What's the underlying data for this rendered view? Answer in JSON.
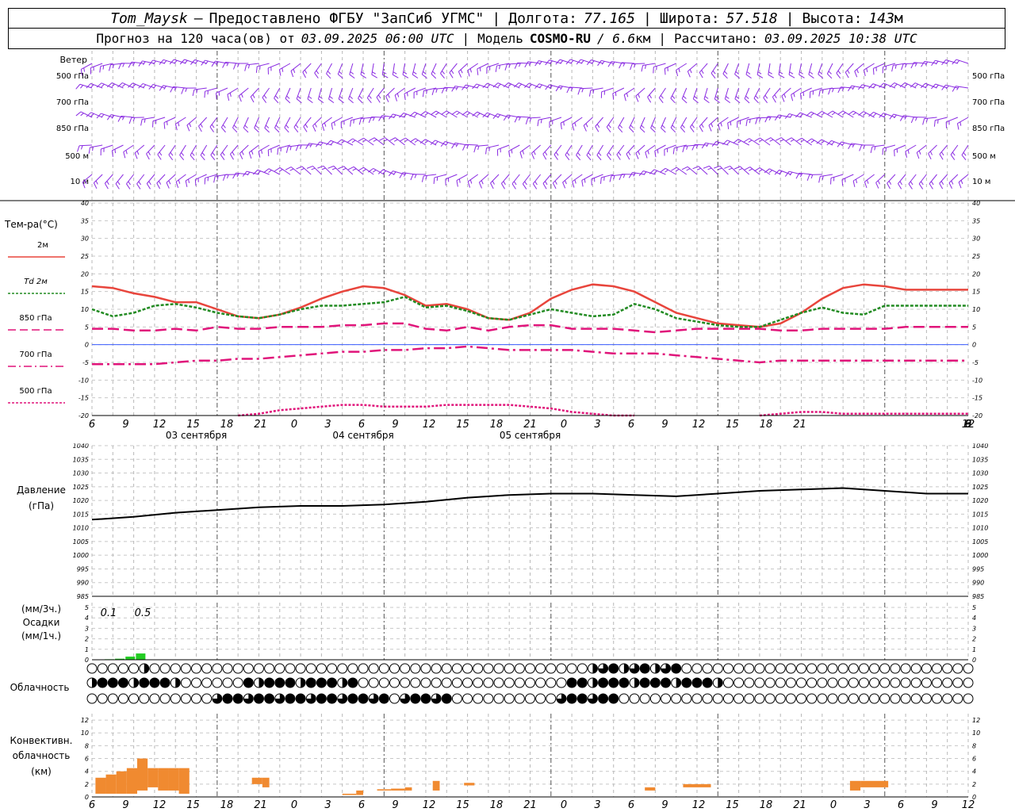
{
  "header": {
    "station": "Tom_Maysk",
    "provider": "Предоставлено ФГБУ \"ЗапСиб УГМС\"",
    "lon_label": "Долгота:",
    "lon": "77.165",
    "lat_label": "Широта:",
    "lat": "57.518",
    "alt_label": "Высота:",
    "alt": "143",
    "alt_unit": "м",
    "forecast_prefix": "Прогноз на 120 часа(ов) от",
    "forecast_start": "03.09.2025 06:00 UTC",
    "model_label": "Модель",
    "model": "COSMO-RU",
    "model_res": "/ 6.6",
    "model_res_unit": "км",
    "calc_label": "Рассчитано:",
    "calc_time": "03.09.2025 10:38 UTC"
  },
  "time_axis": {
    "hour_labels": [
      "6",
      "9",
      "12",
      "15",
      "18",
      "21",
      "0",
      "3",
      "6",
      "9",
      "12",
      "15",
      "18",
      "21",
      "0",
      "3",
      "6",
      "9",
      "12",
      "15",
      "18",
      "21",
      "0",
      "3",
      "6",
      "9",
      "12"
    ],
    "date_labels": [
      "03 сентября",
      "04 сентября",
      "05 сентября"
    ]
  },
  "wind_panel": {
    "title": "Ветер",
    "levels": [
      "500 гПа",
      "700 гПа",
      "850 гПа",
      "500 м",
      "10 м"
    ],
    "color": "#8a2be2"
  },
  "temperature": {
    "title": "Тем-ра(°C)",
    "legend": [
      {
        "label": "2м",
        "color": "#e8453c"
      },
      {
        "label": "Td  2м",
        "color": "#228b22"
      },
      {
        "label": "850 гПа",
        "color": "#e0147a"
      },
      {
        "label": "700 гПа",
        "color": "#e0147a"
      },
      {
        "label": "500 гПа",
        "color": "#e0147a"
      }
    ],
    "y_ticks": [
      "40",
      "35",
      "30",
      "25",
      "20",
      "15",
      "10",
      "5",
      "0",
      "-5",
      "-10",
      "-15",
      "-20"
    ]
  },
  "pressure": {
    "title": "Давление",
    "unit": "(гПа)",
    "y_ticks": [
      "1040",
      "1035",
      "1030",
      "1025",
      "1020",
      "1015",
      "1010",
      "1005",
      "1000",
      "995",
      "990",
      "985"
    ]
  },
  "precip": {
    "unit3h": "(мм/3ч.)",
    "title": "Осадки",
    "unit1h": "(мм/1ч.)",
    "y_ticks": [
      "5",
      "4",
      "3",
      "2",
      "1",
      "0"
    ],
    "annotations": [
      "0.1",
      "0.5"
    ],
    "color": "#22cc22"
  },
  "cloud": {
    "title": "Облачность"
  },
  "convective": {
    "title1": "Конвективн.",
    "title2": "облачность",
    "unit": "(км)",
    "y_ticks": [
      "12",
      "10",
      "8",
      "6",
      "4",
      "2",
      "0"
    ],
    "color": "#f08a30"
  },
  "chart_data": [
    {
      "type": "line",
      "name": "temperature",
      "x": [
        0,
        3,
        6,
        9,
        12,
        15,
        18,
        21,
        24,
        27,
        30,
        33,
        36,
        39,
        42,
        45,
        48,
        51,
        54,
        57,
        60,
        63,
        66,
        69,
        72,
        75,
        78,
        81,
        84,
        87,
        90,
        93,
        96,
        99,
        102,
        105,
        108,
        111,
        114,
        117,
        120,
        123,
        126
      ],
      "ylim": [
        -20,
        40
      ],
      "series": [
        {
          "name": "2м",
          "values": [
            16.5,
            16,
            14.5,
            13.5,
            12,
            12,
            10,
            8,
            7.5,
            8.5,
            10.5,
            13,
            15,
            16.5,
            16,
            14,
            11,
            11.5,
            10,
            7.5,
            7,
            9,
            13,
            15.5,
            17,
            16.5,
            15,
            12,
            9,
            7.5,
            6,
            5.5,
            5,
            6,
            9,
            13,
            16,
            17,
            16.5,
            15.5,
            15.5,
            15.5,
            15.5
          ]
        },
        {
          "name": "Td  2м",
          "values": [
            10,
            8,
            9,
            11,
            11.5,
            10.5,
            9,
            8,
            7.5,
            8.5,
            10,
            11,
            11,
            11.5,
            12,
            13.5,
            10.5,
            11,
            9.5,
            7.5,
            7,
            8.5,
            10,
            9,
            8,
            8.5,
            11.5,
            10,
            7.5,
            6.5,
            5.5,
            5,
            5,
            7,
            9,
            10.5,
            9,
            8.5,
            11,
            11,
            11,
            11,
            11
          ]
        },
        {
          "name": "850 гПа",
          "values": [
            4.5,
            4.5,
            4,
            4,
            4.5,
            4,
            5,
            4.5,
            4.5,
            5,
            5,
            5,
            5.5,
            5.5,
            6,
            6,
            4.5,
            4,
            5,
            4,
            5,
            5.5,
            5.5,
            4.5,
            4.5,
            4.5,
            4,
            3.5,
            4,
            4.5,
            4.5,
            4.5,
            4.5,
            4,
            4,
            4.5,
            4.5,
            4.5,
            4.5,
            5,
            5,
            5,
            5
          ]
        },
        {
          "name": "700 гПа",
          "values": [
            -5.5,
            -5.5,
            -5.5,
            -5.5,
            -5,
            -4.5,
            -4.5,
            -4,
            -4,
            -3.5,
            -3,
            -2.5,
            -2,
            -2,
            -1.5,
            -1.5,
            -1,
            -1,
            -0.5,
            -1,
            -1.5,
            -1.5,
            -1.5,
            -1.5,
            -2,
            -2.5,
            -2.5,
            -2.5,
            -3,
            -3.5,
            -4,
            -4.5,
            -5,
            -4.5,
            -4.5,
            -4.5,
            -4.5,
            -4.5,
            -4.5,
            -4.5,
            -4.5,
            -4.5,
            -4.5
          ]
        },
        {
          "name": "500 гПа",
          "values": [
            null,
            null,
            null,
            null,
            null,
            null,
            null,
            -20,
            -19.5,
            -18.5,
            -18,
            -17.5,
            -17,
            -17,
            -17.5,
            -17.5,
            -17.5,
            -17,
            -17,
            -17,
            -17,
            -17.5,
            -18,
            -19,
            -19.5,
            -20,
            -20,
            null,
            null,
            null,
            null,
            null,
            -20,
            -19.5,
            -19,
            -19,
            -19.5,
            -19.5,
            -19.5,
            -19.5,
            -19.5,
            -19.5,
            -19.5
          ]
        }
      ]
    },
    {
      "type": "line",
      "name": "pressure",
      "x": [
        0,
        6,
        12,
        18,
        24,
        30,
        36,
        42,
        48,
        54,
        60,
        66,
        72,
        78,
        84,
        90,
        96,
        102,
        108,
        114,
        120,
        126
      ],
      "ylim": [
        985,
        1040
      ],
      "series": [
        {
          "name": "Давление",
          "values": [
            1013,
            1014,
            1015.5,
            1016.5,
            1017.5,
            1018,
            1018,
            1018.5,
            1019.5,
            1021,
            1022,
            1022.5,
            1022.5,
            1022,
            1021.5,
            1022.5,
            1023.5,
            1024,
            1024.5,
            1023.5,
            1022.5,
            1022.5
          ]
        }
      ]
    },
    {
      "type": "bar",
      "name": "precipitation",
      "x": [
        2.5,
        4,
        5.5,
        7
      ],
      "ylim": [
        0,
        5
      ],
      "values": [
        0.05,
        0.1,
        0.3,
        0.6
      ]
    },
    {
      "type": "bar",
      "name": "convective",
      "ylim": [
        0,
        13
      ],
      "segments": [
        {
          "from": 0.5,
          "to": 2,
          "base": 0.5,
          "top": 3
        },
        {
          "from": 2,
          "to": 3.5,
          "base": 0.5,
          "top": 3.5
        },
        {
          "from": 3.5,
          "to": 5,
          "base": 0.5,
          "top": 4
        },
        {
          "from": 5,
          "to": 6.5,
          "base": 0.5,
          "top": 4.5
        },
        {
          "from": 6.5,
          "to": 8,
          "base": 1,
          "top": 6
        },
        {
          "from": 8,
          "to": 9.5,
          "base": 1.5,
          "top": 4.5
        },
        {
          "from": 9.5,
          "to": 11,
          "base": 1,
          "top": 4.5
        },
        {
          "from": 11,
          "to": 12.5,
          "base": 1,
          "top": 4.5
        },
        {
          "from": 12.5,
          "to": 14,
          "base": 0.5,
          "top": 4.5
        },
        {
          "from": 23,
          "to": 24.5,
          "base": 2,
          "top": 3
        },
        {
          "from": 24.5,
          "to": 25.5,
          "base": 1.5,
          "top": 3
        },
        {
          "from": 36,
          "to": 38,
          "base": 0.3,
          "top": 0.5
        },
        {
          "from": 38,
          "to": 39,
          "base": 0.3,
          "top": 1
        },
        {
          "from": 41,
          "to": 43,
          "base": 1,
          "top": 1.2
        },
        {
          "from": 43,
          "to": 45,
          "base": 1,
          "top": 1.3
        },
        {
          "from": 45,
          "to": 46,
          "base": 1,
          "top": 1.5
        },
        {
          "from": 49,
          "to": 50,
          "base": 1,
          "top": 2.5
        },
        {
          "from": 53.5,
          "to": 55,
          "base": 1.8,
          "top": 2.2
        },
        {
          "from": 79.5,
          "to": 81,
          "base": 1,
          "top": 1.5
        },
        {
          "from": 85,
          "to": 89,
          "base": 1.5,
          "top": 2
        },
        {
          "from": 109,
          "to": 110.5,
          "base": 1,
          "top": 2.5
        },
        {
          "from": 110.5,
          "to": 113,
          "base": 1.5,
          "top": 2.5
        },
        {
          "from": 113,
          "to": 114.5,
          "base": 1.5,
          "top": 2.5
        }
      ]
    }
  ]
}
